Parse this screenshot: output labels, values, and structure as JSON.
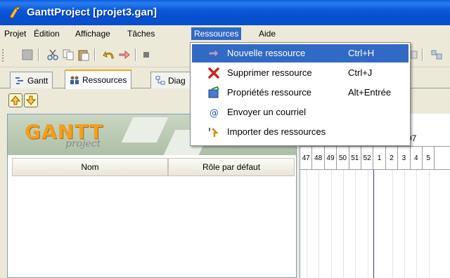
{
  "window": {
    "title": "GanttProject [projet3.gan]"
  },
  "menubar": {
    "items": [
      "Projet",
      "Édition",
      "Affichage",
      "Tâches",
      "Ressources",
      "Aide"
    ],
    "active": "Ressources"
  },
  "tabs": [
    {
      "label": "Gantt",
      "icon": "gantt-icon"
    },
    {
      "label": "Ressources",
      "icon": "resources-icon",
      "active": true
    },
    {
      "label": "Diag",
      "icon": "diagram-icon"
    }
  ],
  "logo": {
    "text": "GANTT",
    "sub": "project"
  },
  "resource_table": {
    "columns": [
      "Nom",
      "Rôle par défaut"
    ]
  },
  "chart": {
    "date_fragment": "07",
    "weeks": [
      "47",
      "48",
      "49",
      "50",
      "51",
      "52",
      "1",
      "2",
      "3",
      "4",
      "5"
    ]
  },
  "resources_menu": [
    {
      "label": "Nouvelle ressource",
      "accel": "Ctrl+H",
      "icon": "new-resource-icon",
      "highlighted": true
    },
    {
      "label": "Supprimer ressource",
      "accel": "Ctrl+J",
      "icon": "delete-icon"
    },
    {
      "label": "Propriétés ressource",
      "accel": "Alt+Entrée",
      "icon": "properties-icon"
    },
    {
      "label": "Envoyer un courriel",
      "accel": "",
      "icon": "email-icon"
    },
    {
      "label": "Importer des ressources",
      "accel": "",
      "icon": "import-icon"
    }
  ],
  "colors": {
    "titlebar": "#0a58d8",
    "highlight": "#316ac5",
    "logo": "#f0a020"
  }
}
